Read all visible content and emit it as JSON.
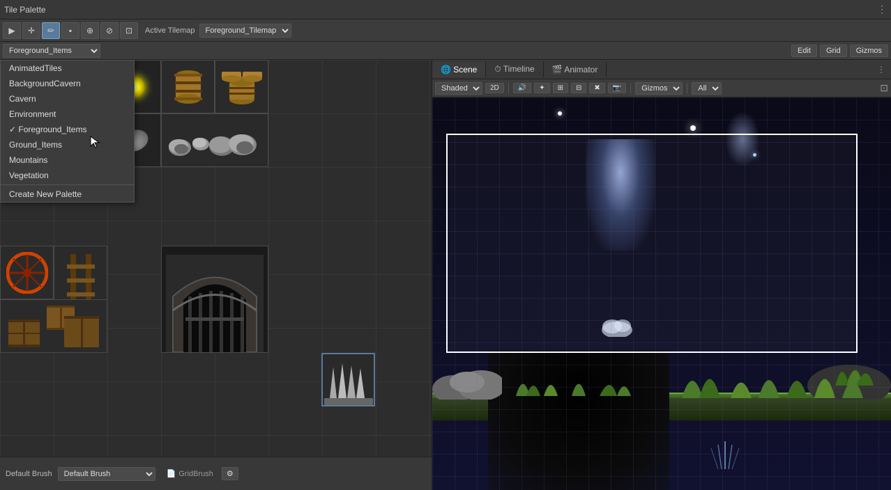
{
  "window": {
    "title": "Tile Palette"
  },
  "toolbar": {
    "tools": [
      {
        "id": "select",
        "icon": "▶",
        "label": "Select",
        "active": false
      },
      {
        "id": "move",
        "icon": "✛",
        "label": "Move",
        "active": false
      },
      {
        "id": "paint",
        "icon": "✏",
        "label": "Paint",
        "active": true
      },
      {
        "id": "box",
        "icon": "▪",
        "label": "Box",
        "active": false
      },
      {
        "id": "pick",
        "icon": "⊕",
        "label": "Pick",
        "active": false
      },
      {
        "id": "erase",
        "icon": "⊘",
        "label": "Erase",
        "active": false
      },
      {
        "id": "fill",
        "icon": "⊡",
        "label": "Fill",
        "active": false
      }
    ],
    "active_tilemap_label": "Active Tilemap",
    "active_tilemap_value": "Foreground_Tilemap"
  },
  "palette": {
    "selected": "Foreground_Items",
    "options": [
      "AnimatedTiles",
      "BackgroundCavern",
      "Cavern",
      "Environment",
      "Foreground_Items",
      "Ground_Items",
      "Mountains",
      "Vegetation"
    ],
    "create_new_label": "Create New Palette",
    "edit_label": "Edit",
    "grid_label": "Grid",
    "gizmos_label": "Gizmos"
  },
  "bottom_bar": {
    "brush_label": "Default Brush",
    "brush_select_placeholder": "Default Brush",
    "script_label": "Script",
    "script_value": "GridBrush"
  },
  "scene": {
    "tabs": [
      {
        "id": "scene",
        "label": "Scene",
        "active": true
      },
      {
        "id": "timeline",
        "label": "Timeline",
        "active": false
      },
      {
        "id": "animator",
        "label": "Animator",
        "active": false
      }
    ],
    "toolbar": {
      "shading": "Shaded",
      "view_2d": "2D",
      "gizmos": "Gizmos",
      "gizmos_dropdown": "▼",
      "all_label": "All",
      "dots_icon": "⋮"
    }
  },
  "dropdown": {
    "visible": true,
    "items": [
      {
        "label": "AnimatedTiles",
        "checked": false
      },
      {
        "label": "BackgroundCavern",
        "checked": false
      },
      {
        "label": "Cavern",
        "checked": false
      },
      {
        "label": "Environment",
        "checked": false
      },
      {
        "label": "Foreground_Items",
        "checked": true
      },
      {
        "label": "Ground_Items",
        "checked": false
      },
      {
        "label": "Mountains",
        "checked": false
      },
      {
        "label": "Vegetation",
        "checked": false
      }
    ],
    "create_new_label": "Create New Palette"
  }
}
